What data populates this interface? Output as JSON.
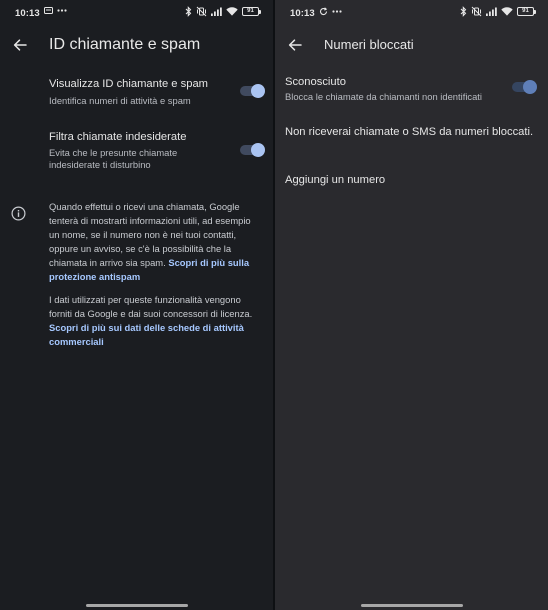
{
  "left": {
    "status": {
      "time": "10:13",
      "battery": "91"
    },
    "title": "ID chiamante e spam",
    "settings": [
      {
        "title": "Visualizza ID chiamante e spam",
        "subtitle": "Identifica numeri di attività e spam",
        "enabled": true
      },
      {
        "title": "Filtra chiamate indesiderate",
        "subtitle": "Evita che le presunte chiamate indesiderate ti disturbino",
        "enabled": true
      }
    ],
    "info": {
      "para1": "Quando effettui o ricevi una chiamata, Google tenterà di mostrarti informazioni utili, ad esempio un nome, se il numero non è nei tuoi contatti, oppure un avviso, se c'è la possibilità che la chiamata in arrivo sia spam. ",
      "link1": "Scopri di più sulla protezione antispam",
      "para2": "I dati utilizzati per queste funzionalità vengono forniti da Google e dai suoi concessori di licenza. ",
      "link2": "Scopri di più sui dati delle schede di attività commerciali"
    },
    "icons": [
      "back-arrow-icon",
      "info-icon",
      "message-icon",
      "more-icon",
      "bluetooth-icon",
      "vibrate-off-icon",
      "signal-icon",
      "wifi-icon",
      "battery-icon"
    ]
  },
  "right": {
    "status": {
      "time": "10:13",
      "battery": "91"
    },
    "title": "Numeri bloccati",
    "unknown": {
      "title": "Sconosciuto",
      "subtitle": "Blocca le chiamate da chiamanti non identificati",
      "enabled": true
    },
    "notice": "Non riceverai chiamate o SMS da numeri bloccati.",
    "add_number": "Aggiungi un numero",
    "icons": [
      "back-arrow-icon",
      "sync-icon",
      "more-icon",
      "bluetooth-icon",
      "vibrate-off-icon",
      "signal-icon",
      "wifi-icon",
      "battery-icon"
    ]
  },
  "colors": {
    "left_bg": "#1b1d21",
    "right_bg": "#2a2a2e",
    "link": "#a6c8ff",
    "toggle_on_knob": "#aac4f2"
  }
}
